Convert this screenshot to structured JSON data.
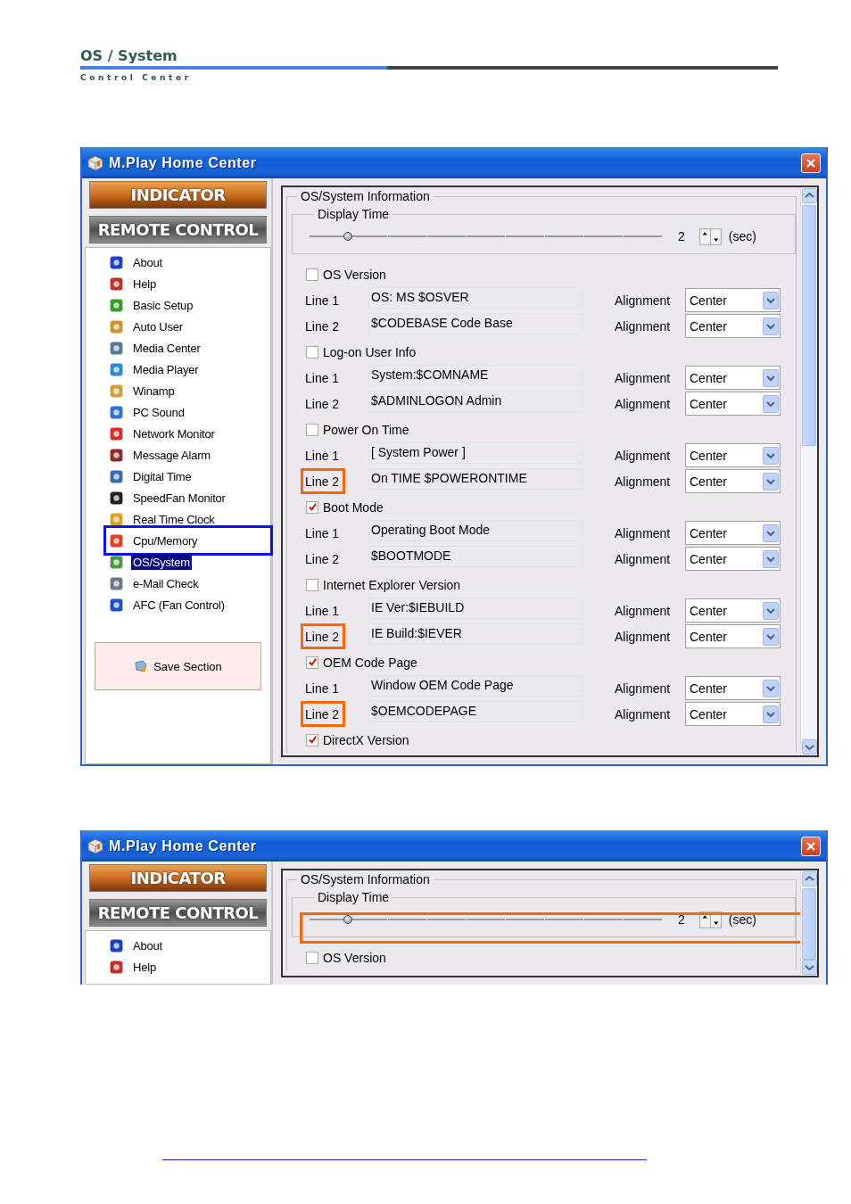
{
  "header": {
    "title": "OS / System",
    "subtitle": "Control Center"
  },
  "windows": [
    {
      "title": "M.Play Home Center",
      "mode_buttons": [
        {
          "label": "INDICATOR",
          "selected": true
        },
        {
          "label": "REMOTE CONTROL",
          "selected": false
        }
      ],
      "menu": [
        {
          "label": "About",
          "selected": false
        },
        {
          "label": "Help",
          "selected": false
        },
        {
          "label": "Basic Setup",
          "selected": false
        },
        {
          "label": "Auto User",
          "selected": false
        },
        {
          "label": "Media Center",
          "selected": false
        },
        {
          "label": "Media Player",
          "selected": false
        },
        {
          "label": "Winamp",
          "selected": false
        },
        {
          "label": "PC Sound",
          "selected": false
        },
        {
          "label": "Network Monitor",
          "selected": false
        },
        {
          "label": "Message Alarm",
          "selected": false
        },
        {
          "label": "Digital Time",
          "selected": false
        },
        {
          "label": "SpeedFan Monitor",
          "selected": false
        },
        {
          "label": "Real Time Clock",
          "selected": false
        },
        {
          "label": "Cpu/Memory",
          "selected": false,
          "callout": true
        },
        {
          "label": "OS/System",
          "selected": true
        },
        {
          "label": "e-Mail Check",
          "selected": false
        },
        {
          "label": "AFC (Fan Control)",
          "selected": false
        }
      ],
      "save_button": "Save Section",
      "panel": {
        "group_title": "OS/System Information",
        "display_time": {
          "label": "Display Time",
          "level": 0.11,
          "value": "2",
          "unit": "(sec)"
        },
        "sections": [
          {
            "title": "OS Version",
            "checked": false,
            "rows": [
              {
                "label": "Line 1",
                "text": "OS: MS $OSVER",
                "alignment_label": "Alignment",
                "alignment": "Center"
              },
              {
                "label": "Line 2",
                "text": "$CODEBASE Code Base",
                "alignment_label": "Alignment",
                "alignment": "Center"
              }
            ]
          },
          {
            "title": "Log-on User Info",
            "checked": false,
            "rows": [
              {
                "label": "Line 1",
                "text": "System:$COMNAME",
                "alignment_label": "Alignment",
                "alignment": "Center"
              },
              {
                "label": "Line 2",
                "text": "$ADMINLOGON Admin",
                "alignment_label": "Alignment",
                "alignment": "Center"
              }
            ]
          },
          {
            "title": "Power On Time",
            "checked": false,
            "rows": [
              {
                "label": "Line 1",
                "text": "[ System Power ]",
                "alignment_label": "Alignment",
                "alignment": "Center"
              },
              {
                "label": "Line 2",
                "text": "On TIME $POWERONTIME",
                "alignment_label": "Alignment",
                "alignment": "Center",
                "callout": true
              }
            ]
          },
          {
            "title": "Boot Mode",
            "checked": true,
            "rows": [
              {
                "label": "Line 1",
                "text": "Operating Boot Mode",
                "alignment_label": "Alignment",
                "alignment": "Center"
              },
              {
                "label": "Line 2",
                "text": "$BOOTMODE",
                "alignment_label": "Alignment",
                "alignment": "Center"
              }
            ]
          },
          {
            "title": "Internet Explorer Version",
            "checked": false,
            "rows": [
              {
                "label": "Line 1",
                "text": "IE Ver:$IEBUILD",
                "alignment_label": "Alignment",
                "alignment": "Center"
              },
              {
                "label": "Line 2",
                "text": "IE Build:$IEVER",
                "alignment_label": "Alignment",
                "alignment": "Center",
                "callout": true
              }
            ]
          },
          {
            "title": "OEM Code Page",
            "checked": true,
            "rows": [
              {
                "label": "Line 1",
                "text": "Window OEM Code Page",
                "alignment_label": "Alignment",
                "alignment": "Center"
              },
              {
                "label": "Line 2",
                "text": "$OEMCODEPAGE",
                "alignment_label": "Alignment",
                "alignment": "Center",
                "callout": true
              }
            ]
          },
          {
            "title": "DirectX Version",
            "checked": true
          }
        ]
      }
    },
    {
      "title": "M.Play Home Center",
      "mode_buttons": [
        {
          "label": "INDICATOR",
          "selected": true
        },
        {
          "label": "REMOTE CONTROL",
          "selected": false
        }
      ],
      "menu": [
        {
          "label": "About",
          "selected": false
        },
        {
          "label": "Help",
          "selected": false
        }
      ],
      "panel": {
        "group_title": "OS/System Information",
        "display_time": {
          "label": "Display Time",
          "level": 0.11,
          "value": "2",
          "unit": "(sec)",
          "callout": true
        },
        "sections": [
          {
            "title": "OS Version",
            "checked": false
          }
        ]
      }
    }
  ]
}
